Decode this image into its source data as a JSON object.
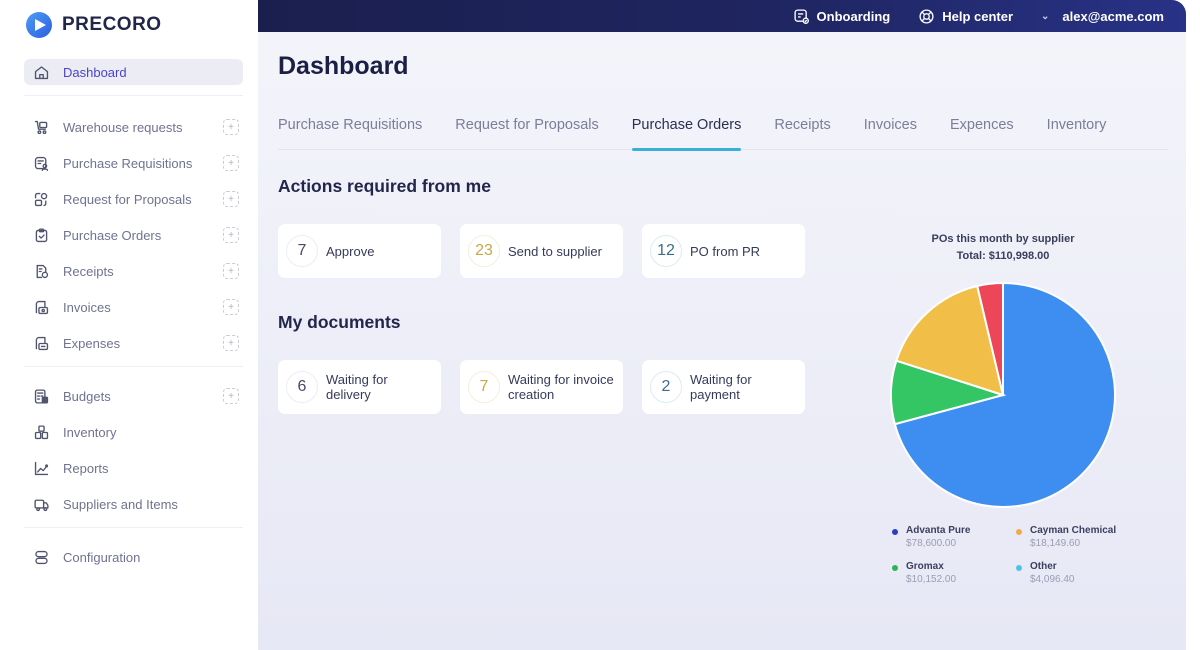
{
  "brand": {
    "name": "PRECORO"
  },
  "sidebar": {
    "groups": [
      [
        {
          "label": "Dashboard",
          "icon": "home-icon",
          "active": true,
          "add": false
        }
      ],
      [
        {
          "label": "Warehouse requests",
          "icon": "cart-icon",
          "add": true
        },
        {
          "label": "Purchase Requisitions",
          "icon": "requisition-icon",
          "add": true
        },
        {
          "label": "Request for Proposals",
          "icon": "proposal-icon",
          "add": true
        },
        {
          "label": "Purchase Orders",
          "icon": "clipboard-check-icon",
          "add": true
        },
        {
          "label": "Receipts",
          "icon": "receipt-icon",
          "add": true
        },
        {
          "label": "Invoices",
          "icon": "invoice-icon",
          "add": true
        },
        {
          "label": "Expenses",
          "icon": "expense-icon",
          "add": true
        }
      ],
      [
        {
          "label": "Budgets",
          "icon": "calculator-icon",
          "add": true
        },
        {
          "label": "Inventory",
          "icon": "boxes-icon",
          "add": false
        },
        {
          "label": "Reports",
          "icon": "chart-line-icon",
          "add": false
        },
        {
          "label": "Suppliers and Items",
          "icon": "truck-icon",
          "add": false
        }
      ],
      [
        {
          "label": "Configuration",
          "icon": "config-icon",
          "add": false
        }
      ]
    ],
    "add_glyph": "+"
  },
  "topbar": {
    "onboarding": "Onboarding",
    "help": "Help center",
    "user_chevron": "⌄",
    "user": "alex@acme.com"
  },
  "page": {
    "title": "Dashboard"
  },
  "tabs": [
    {
      "label": "Purchase Requisitions",
      "active": false
    },
    {
      "label": "Request for Proposals",
      "active": false
    },
    {
      "label": "Purchase Orders",
      "active": true
    },
    {
      "label": "Receipts",
      "active": false
    },
    {
      "label": "Invoices",
      "active": false
    },
    {
      "label": "Expences",
      "active": false
    },
    {
      "label": "Inventory",
      "active": false
    }
  ],
  "actions": {
    "title": "Actions required from me",
    "cards": [
      {
        "count": "7",
        "label": "Approve",
        "tone": "gray"
      },
      {
        "count": "23",
        "label": "Send to supplier",
        "tone": "yellow"
      },
      {
        "count": "12",
        "label": "PO from PR",
        "tone": "teal"
      }
    ]
  },
  "documents": {
    "title": "My documents",
    "cards": [
      {
        "count": "6",
        "label": "Waiting for delivery",
        "tone": "gray"
      },
      {
        "count": "7",
        "label": "Waiting for invoice creation",
        "tone": "yellow"
      },
      {
        "count": "2",
        "label": "Waiting for payment",
        "tone": "teal"
      }
    ]
  },
  "chart_data": {
    "type": "pie",
    "title": "POs this month by supplier",
    "subtitle": "Total: $110,998.00",
    "total": 110998.0,
    "legend_placement": "bottom",
    "series": [
      {
        "name": "Advanta Pure",
        "value": 78600.0,
        "display": "$78,600.00",
        "color": "#3d8ef0",
        "legend_color": "#2b3bc4"
      },
      {
        "name": "Gromax",
        "value": 10152.0,
        "display": "$10,152.00",
        "color": "#34c565",
        "legend_color": "#2fb35a"
      },
      {
        "name": "Cayman Chemical",
        "value": 18149.6,
        "display": "$18,149.60",
        "color": "#f1bf47",
        "legend_color": "#f2a94a"
      },
      {
        "name": "Other",
        "value": 4096.4,
        "display": "$4,096.40",
        "color": "#ee4659",
        "legend_color": "#4cc3ea"
      }
    ],
    "slice_order": "clockwise from top"
  }
}
